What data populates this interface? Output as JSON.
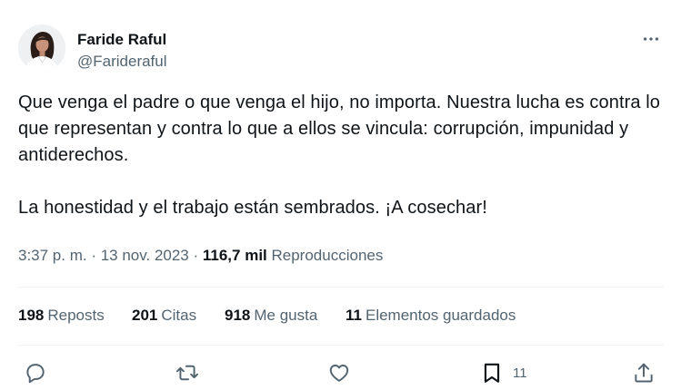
{
  "author": {
    "name": "Faride Raful",
    "handle": "@Farideraful"
  },
  "tweet": {
    "paragraph1": "Que venga el padre o que venga el hijo, no importa. Nuestra lucha es contra lo que representan y contra lo que a ellos se vincula: corrupción, impunidad y antiderechos.",
    "paragraph2": "La honestidad y el trabajo están sembrados. ¡A cosechar!"
  },
  "meta": {
    "time": "3:37 p. m.",
    "sep1": " · ",
    "date": "13 nov. 2023",
    "sep2": " · ",
    "views_count": "116,7 mil",
    "views_label": "Reproducciones"
  },
  "stats": {
    "reposts_count": "198",
    "reposts_label": "Reposts",
    "quotes_count": "201",
    "quotes_label": "Citas",
    "likes_count": "918",
    "likes_label": "Me gusta",
    "bookmarks_count": "11",
    "bookmarks_label": "Elementos guardados"
  },
  "actions": {
    "bookmark_count": "11"
  },
  "icons": {
    "more": "more-icon",
    "reply": "reply-icon",
    "repost": "repost-icon",
    "like": "like-icon",
    "bookmark": "bookmark-icon",
    "share": "share-icon"
  },
  "colors": {
    "text": "#0f1419",
    "secondary": "#536471",
    "divider": "#eff3f4"
  }
}
